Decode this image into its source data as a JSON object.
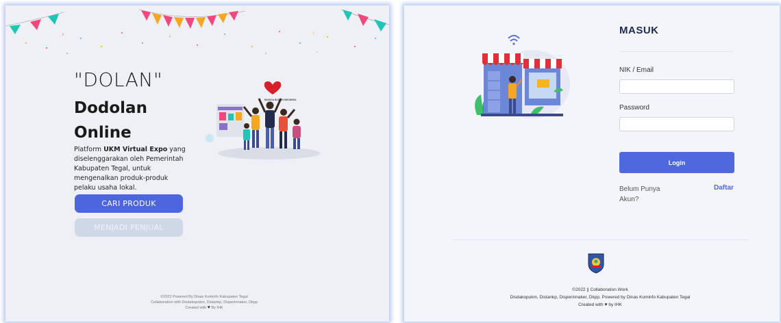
{
  "left": {
    "hero_quote": "\"DOLAN\"",
    "hero_title_line1": "Dodolan",
    "hero_title_line2": "Online",
    "desc_prefix": "Platform ",
    "desc_bold": "UKM Virtual Expo",
    "desc_suffix": " yang diselenggarakan oleh Pemerintah Kabupaten Tegal, untuk mengenalkan produk-produk pelaku usaha lokal.",
    "btn_find_product": "CARI PRODUK",
    "btn_become_seller": "MENJADI PENJUAL",
    "footer_line1": "©2022 Powered By Dinas Kominfo Kabupaten Tegal",
    "footer_line2": "Collaboration with Disdakopukm, Distankp, Disperinnaker, Dkpp",
    "footer_line3_pre": "Created with",
    "footer_line3_post": "By IHK",
    "illustration_badge": "BANGGA BUATAN INDONESIA"
  },
  "right": {
    "title": "MASUK",
    "nik_label": "NIK / Email",
    "nik_value": "",
    "password_label": "Password",
    "password_value": "",
    "login_button": "Login",
    "no_account_text": "Belum Punya Akun?",
    "register_link": "Daftar",
    "footer_line1": "©2022 || Collaboration Work",
    "footer_line2": "Disdakopukm, Distankp, Disperinnaker, Dkpp. Powered by Dinas Kominfo Kabupaten Tegal",
    "footer_line3_pre": "Created with",
    "footer_line3_post": "by IHK"
  },
  "colors": {
    "primary": "#4d66e0",
    "secondary_disabled": "#cfd8e6",
    "title_navy": "#1c2a52",
    "panel_bg_left": "#eef0f5",
    "panel_bg_right": "#f4f5fa"
  },
  "icons": [
    "bunting-decoration",
    "heart-icon",
    "shop-illustration",
    "wifi-icon",
    "people-celebration-illustration",
    "regency-emblem-icon"
  ]
}
